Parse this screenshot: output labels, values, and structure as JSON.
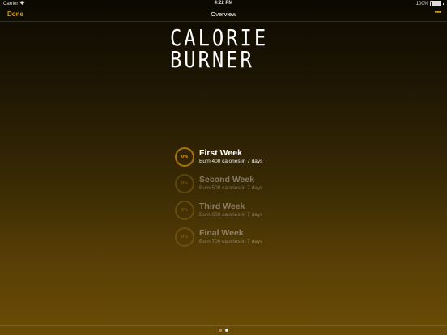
{
  "status_bar": {
    "carrier": "Carrier",
    "time": "4:22 PM",
    "battery": "100%"
  },
  "nav": {
    "done_label": "Done",
    "title": "Overview",
    "more_label": "•••"
  },
  "logo": {
    "line1": "CALORIE",
    "line2": "BURNER"
  },
  "weeks": [
    {
      "title": "First Week",
      "subtitle": "Burn 400 calories in 7 days",
      "progress": "0%",
      "active": true
    },
    {
      "title": "Second Week",
      "subtitle": "Burn 500 calories in 7 days",
      "progress": "0%",
      "active": false
    },
    {
      "title": "Third Week",
      "subtitle": "Burn 600 calories in 7 days",
      "progress": "0%",
      "active": false
    },
    {
      "title": "Final Week",
      "subtitle": "Burn 700 calories in 7 days",
      "progress": "0%",
      "active": false
    }
  ],
  "colors": {
    "accent": "#d99a14",
    "ring_active": "#a8740d"
  },
  "page_indicator": {
    "current_page": 2,
    "total_pages": 2
  }
}
